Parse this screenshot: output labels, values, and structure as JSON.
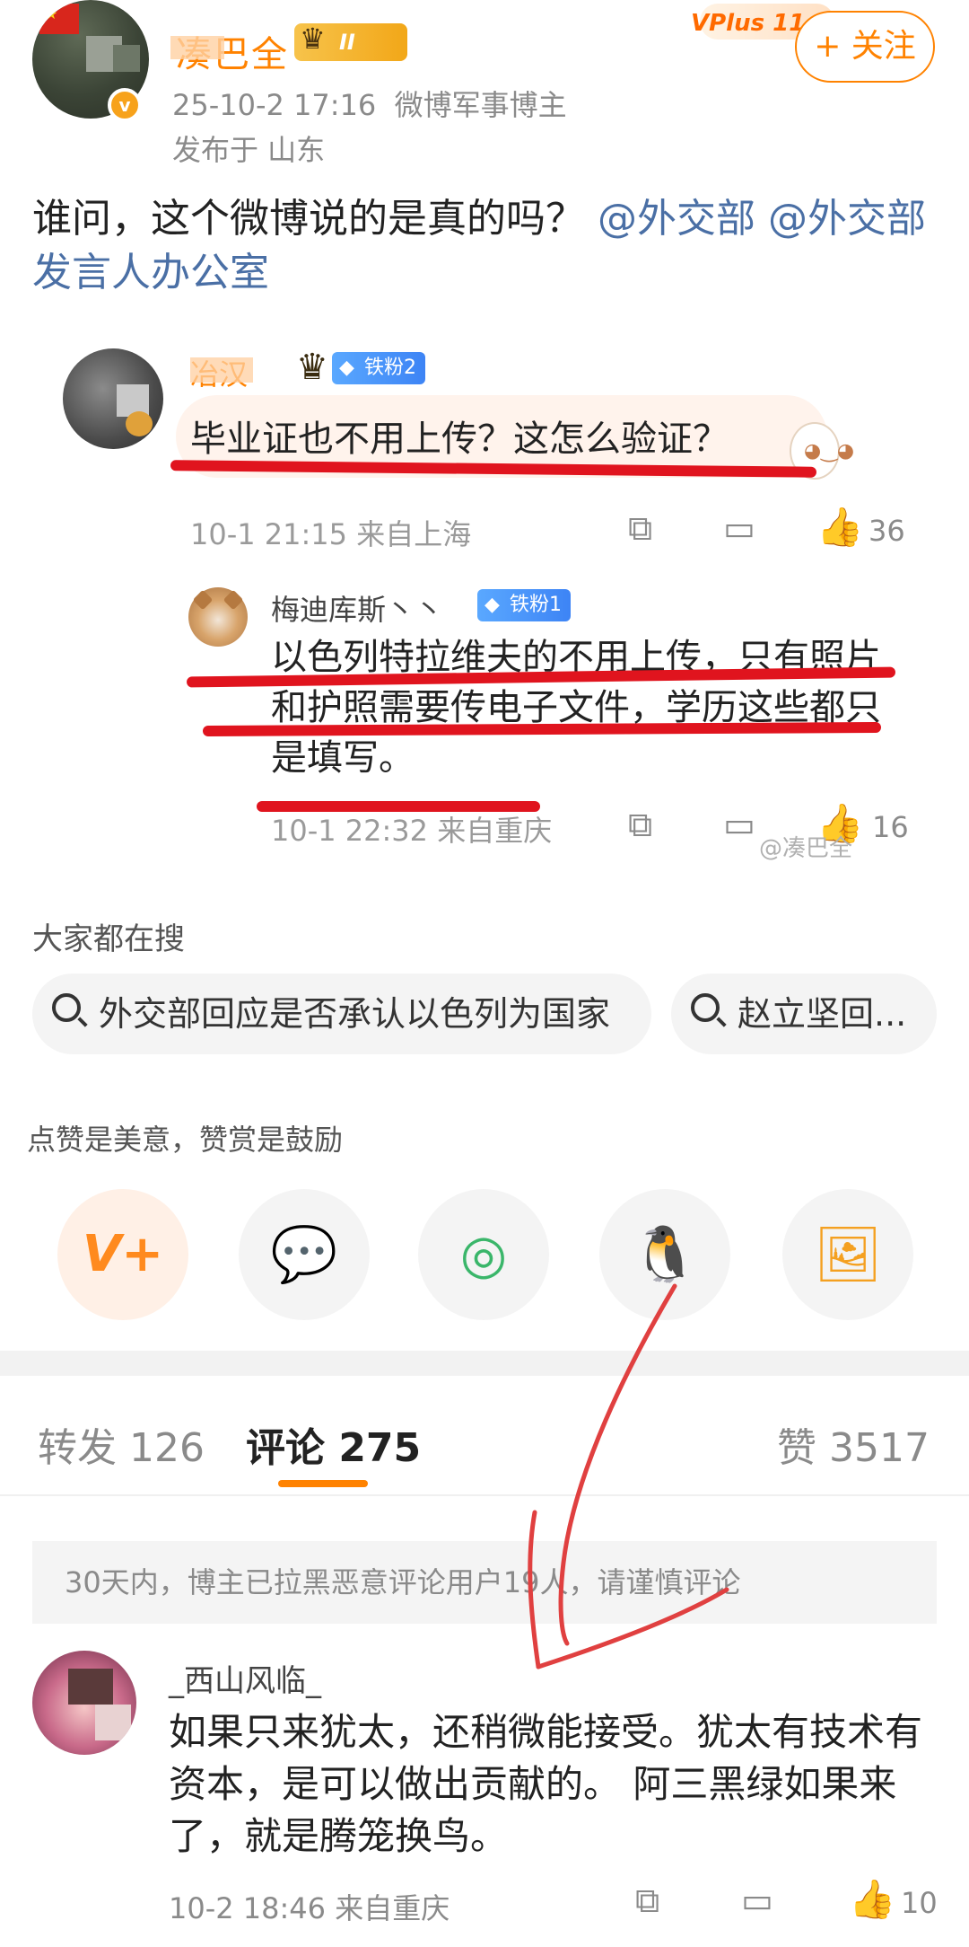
{
  "header": {
    "username": "凑巴全",
    "level_badge": "II",
    "post_time": "25-10-2 17:16",
    "user_title": "微博军事博主",
    "location": "发布于 山东",
    "vplus": "VPlus 11·11",
    "follow_label": "+ 关注"
  },
  "post": {
    "text": "谁问，这个微博说的是真的吗？",
    "mention1": "@外交部",
    "mention2": "@外交部发言人办公室"
  },
  "embedded": {
    "comment1": {
      "name": "冶汉",
      "fan_badge": "铁粉2",
      "text": "毕业证也不用上传？这怎么验证？",
      "time": "10-1 21:15 来自上海",
      "likes": "36"
    },
    "comment2": {
      "name": "梅迪库斯丶丶",
      "fan_badge": "铁粉1",
      "text": "以色列特拉维夫的不用上传，只有照片和护照需要传电子文件，学历这些都只是填写。",
      "time": "10-1 22:32 来自重庆",
      "likes": "16"
    },
    "watermark": "@凑巴全"
  },
  "search": {
    "title": "大家都在搜",
    "chips": [
      "外交部回应是否承认以色列为国家",
      "赵立坚回..."
    ]
  },
  "reward": {
    "title": "点赞是美意，赞赏是鼓励",
    "buttons": [
      "V+",
      "wechat-icon",
      "moments-icon",
      "qq-icon",
      "save-image-icon"
    ]
  },
  "tabs": {
    "repost": "转发 126",
    "comments": "评论 275",
    "likes": "赞 3517"
  },
  "notice": "30天内，博主已拉黑恶意评论用户19人，请谨慎评论",
  "comment": {
    "name": "_西山风临_",
    "text": "如果只来犹太，还稍微能接受。犹太有技术有资本，是可以做出贡献的。 阿三黑绿如果来了，就是腾笼换鸟。",
    "time": "10-2 18:46 来自重庆",
    "likes": "10"
  },
  "colors": {
    "accent": "#ff8200",
    "mention": "#4a6fa5",
    "highlight_red": "#e0141e"
  }
}
